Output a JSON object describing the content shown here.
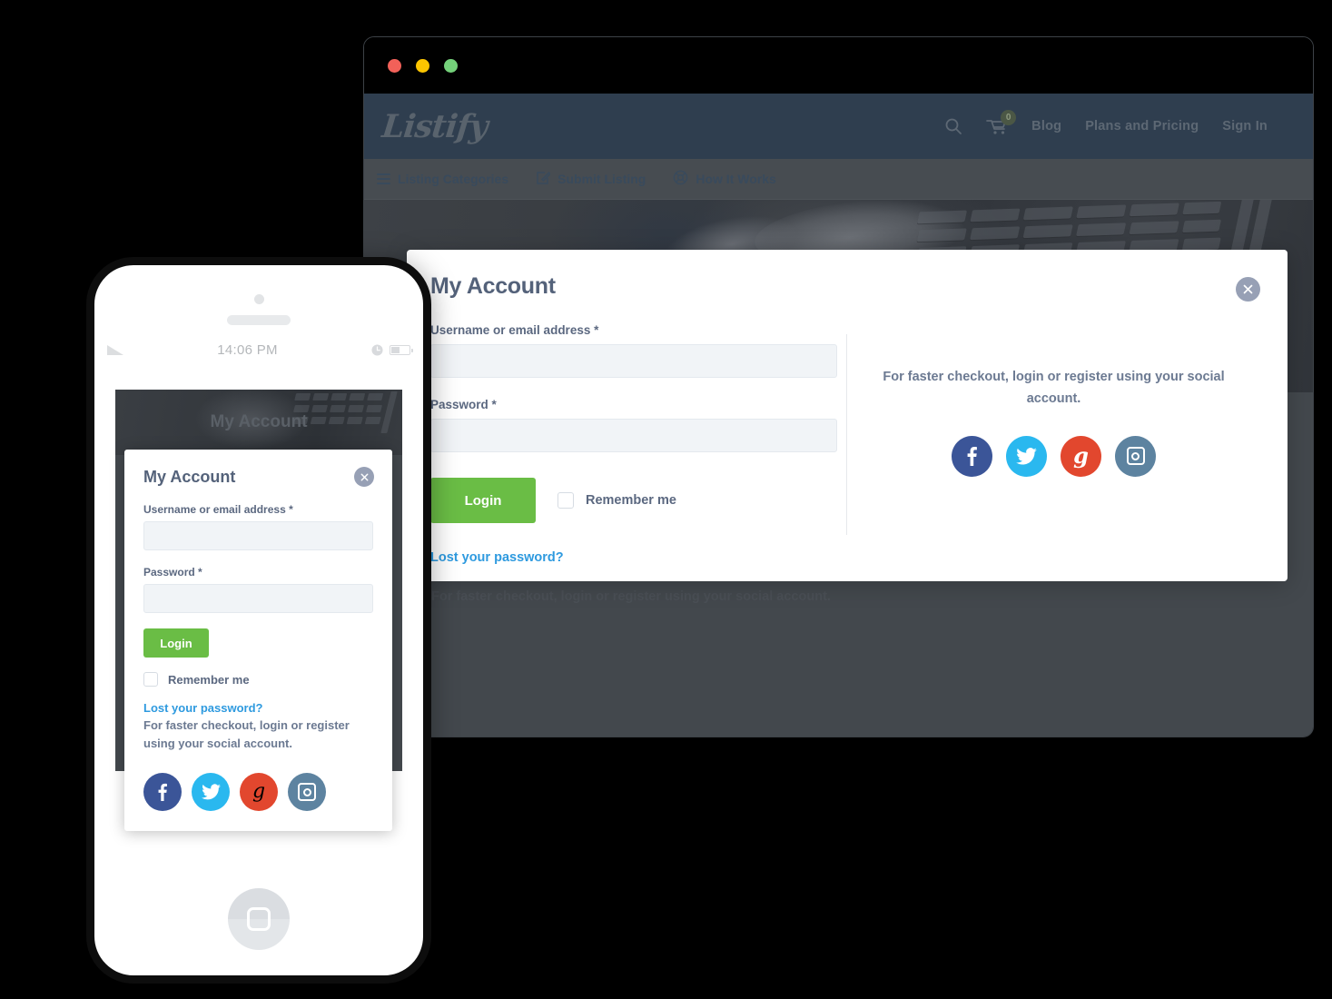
{
  "browser": {
    "traffic_lights": [
      "close-red",
      "minimize-yellow",
      "maximize-green"
    ]
  },
  "site": {
    "logo": "Listify",
    "nav": {
      "search_icon": "search-icon",
      "cart_icon": "cart-icon",
      "cart_count": "0",
      "links": [
        {
          "label": "Blog"
        },
        {
          "label": "Plans and Pricing"
        },
        {
          "label": "Sign In"
        }
      ]
    },
    "subnav": [
      {
        "label": "Listing Categories",
        "icon": "hamburger-menu-icon"
      },
      {
        "label": "Submit Listing",
        "icon": "pencil-square-icon"
      },
      {
        "label": "How It Works",
        "icon": "life-ring-icon"
      }
    ],
    "hero_title": "My Account"
  },
  "modal": {
    "title": "My Account",
    "close_icon": "close-x-icon",
    "username_label": "Username or email address *",
    "username_value": "",
    "username_placeholder": "",
    "password_label": "Password *",
    "password_value": "",
    "password_placeholder": "",
    "login_button": "Login",
    "remember_label": "Remember me",
    "remember_checked": false,
    "lost_password": "Lost your password?",
    "social_text": "For faster checkout, login or register using your social account.",
    "social": [
      {
        "name": "facebook",
        "glyph": "f",
        "color": "#3b5598"
      },
      {
        "name": "twitter",
        "glyph": "🐦",
        "color": "#2ab8ef"
      },
      {
        "name": "google-plus",
        "glyph": "g",
        "color": "#e2472e"
      },
      {
        "name": "instagram",
        "glyph": "□",
        "color": "#5d83a0"
      }
    ]
  },
  "background_form": {
    "login_button": "Login",
    "remember_label": "Remember me",
    "lost_password": "Lost your password?",
    "social_text": "For faster checkout, login or register using your social account."
  },
  "phone": {
    "status_bar": {
      "time": "14:06 PM",
      "signal_icon": "signal-bars-icon",
      "clock_icon": "clock-icon",
      "battery_icon": "battery-icon"
    },
    "hero_title": "My Account",
    "modal": {
      "title": "My Account",
      "close_icon": "close-x-icon",
      "username_label": "Username or email address *",
      "username_value": "",
      "password_label": "Password *",
      "password_value": "",
      "login_button": "Login",
      "remember_label": "Remember me",
      "remember_checked": false,
      "lost_password": "Lost your password?",
      "social_text": "For faster checkout, login or register using your social account."
    },
    "background_text": "your social account.",
    "home_button_icon": "home-square-icon"
  },
  "colors": {
    "navbar": "#2f3e4f",
    "accent_green": "#6abd45",
    "link_blue": "#2e9adf",
    "heading": "#54627a",
    "facebook": "#3b5598",
    "twitter": "#2ab8ef",
    "google": "#e2472e",
    "instagram": "#5d83a0"
  }
}
